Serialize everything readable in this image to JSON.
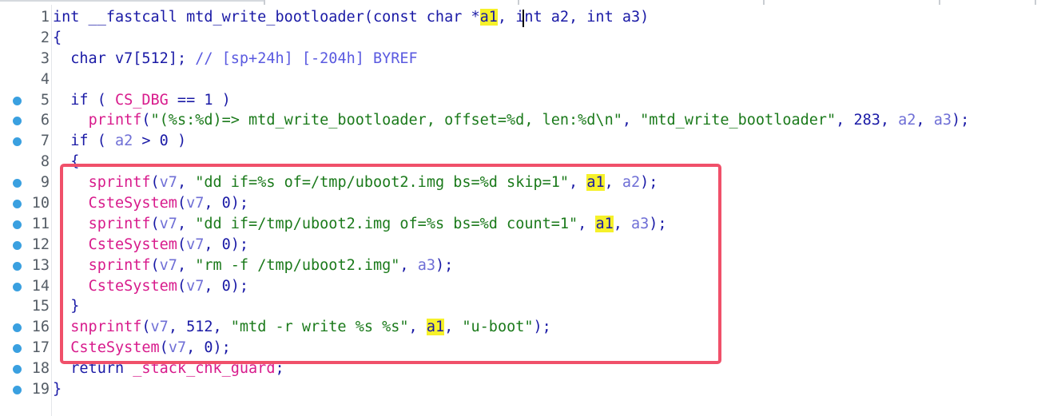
{
  "editor": {
    "lines": [
      {
        "num": "1",
        "bp": false,
        "tokens": [
          [
            "kt",
            "int __fastcall mtd_write_bootloader"
          ],
          [
            "p",
            "("
          ],
          [
            "kt",
            "const char *"
          ],
          [
            "hl",
            "a1"
          ],
          [
            "p",
            ", "
          ],
          [
            "kt",
            "int a2, int a3"
          ],
          [
            "p",
            ")"
          ]
        ]
      },
      {
        "num": "2",
        "bp": false,
        "tokens": [
          [
            "p",
            "{"
          ]
        ]
      },
      {
        "num": "3",
        "bp": false,
        "tokens": [
          [
            "kt",
            "  char v7"
          ],
          [
            "p",
            "["
          ],
          [
            "n",
            "512"
          ],
          [
            "p",
            "]; "
          ],
          [
            "c",
            "// [sp+24h] [-204h] BYREF"
          ]
        ]
      },
      {
        "num": "4",
        "bp": false,
        "tokens": []
      },
      {
        "num": "5",
        "bp": true,
        "tokens": [
          [
            "k",
            "  if ( "
          ],
          [
            "f",
            "CS_DBG"
          ],
          [
            "k",
            " == 1 )"
          ]
        ]
      },
      {
        "num": "6",
        "bp": true,
        "tokens": [
          [
            "p",
            "    "
          ],
          [
            "f",
            "printf"
          ],
          [
            "p",
            "("
          ],
          [
            "s",
            "\"(%s:%d)=> mtd_write_bootloader, offset=%d, len:%d\\n\""
          ],
          [
            "p",
            ", "
          ],
          [
            "s",
            "\"mtd_write_bootloader\""
          ],
          [
            "p",
            ", 283, "
          ],
          [
            "v",
            "a2"
          ],
          [
            "p",
            ", "
          ],
          [
            "v",
            "a3"
          ],
          [
            "p",
            ");"
          ]
        ]
      },
      {
        "num": "7",
        "bp": true,
        "tokens": [
          [
            "k",
            "  if ( "
          ],
          [
            "v",
            "a2"
          ],
          [
            "k",
            " > 0 )"
          ]
        ]
      },
      {
        "num": "8",
        "bp": false,
        "tokens": [
          [
            "p",
            "  {"
          ]
        ]
      },
      {
        "num": "9",
        "bp": true,
        "tokens": [
          [
            "p",
            "    "
          ],
          [
            "f",
            "sprintf"
          ],
          [
            "p",
            "("
          ],
          [
            "v",
            "v7"
          ],
          [
            "p",
            ", "
          ],
          [
            "s",
            "\"dd if=%s of=/tmp/uboot2.img bs=%d skip=1\""
          ],
          [
            "p",
            ", "
          ],
          [
            "hl",
            "a1"
          ],
          [
            "p",
            ", "
          ],
          [
            "v",
            "a2"
          ],
          [
            "p",
            ");"
          ]
        ]
      },
      {
        "num": "10",
        "bp": true,
        "tokens": [
          [
            "p",
            "    "
          ],
          [
            "f",
            "CsteSystem"
          ],
          [
            "p",
            "("
          ],
          [
            "v",
            "v7"
          ],
          [
            "p",
            ", 0);"
          ]
        ]
      },
      {
        "num": "11",
        "bp": true,
        "tokens": [
          [
            "p",
            "    "
          ],
          [
            "f",
            "sprintf"
          ],
          [
            "p",
            "("
          ],
          [
            "v",
            "v7"
          ],
          [
            "p",
            ", "
          ],
          [
            "s",
            "\"dd if=/tmp/uboot2.img of=%s bs=%d count=1\""
          ],
          [
            "p",
            ", "
          ],
          [
            "hl",
            "a1"
          ],
          [
            "p",
            ", "
          ],
          [
            "v",
            "a3"
          ],
          [
            "p",
            ");"
          ]
        ]
      },
      {
        "num": "12",
        "bp": true,
        "tokens": [
          [
            "p",
            "    "
          ],
          [
            "f",
            "CsteSystem"
          ],
          [
            "p",
            "("
          ],
          [
            "v",
            "v7"
          ],
          [
            "p",
            ", 0);"
          ]
        ]
      },
      {
        "num": "13",
        "bp": true,
        "tokens": [
          [
            "p",
            "    "
          ],
          [
            "f",
            "sprintf"
          ],
          [
            "p",
            "("
          ],
          [
            "v",
            "v7"
          ],
          [
            "p",
            ", "
          ],
          [
            "s",
            "\"rm -f /tmp/uboot2.img\""
          ],
          [
            "p",
            ", "
          ],
          [
            "v",
            "a3"
          ],
          [
            "p",
            ");"
          ]
        ]
      },
      {
        "num": "14",
        "bp": true,
        "tokens": [
          [
            "p",
            "    "
          ],
          [
            "f",
            "CsteSystem"
          ],
          [
            "p",
            "("
          ],
          [
            "v",
            "v7"
          ],
          [
            "p",
            ", 0);"
          ]
        ]
      },
      {
        "num": "15",
        "bp": false,
        "tokens": [
          [
            "p",
            "  }"
          ]
        ]
      },
      {
        "num": "16",
        "bp": true,
        "tokens": [
          [
            "p",
            "  "
          ],
          [
            "f",
            "snprintf"
          ],
          [
            "p",
            "("
          ],
          [
            "v",
            "v7"
          ],
          [
            "p",
            ", 512, "
          ],
          [
            "s",
            "\"mtd -r write %s %s\""
          ],
          [
            "p",
            ", "
          ],
          [
            "hl",
            "a1"
          ],
          [
            "p",
            ", "
          ],
          [
            "s",
            "\"u-boot\""
          ],
          [
            "p",
            ");"
          ]
        ]
      },
      {
        "num": "17",
        "bp": true,
        "tokens": [
          [
            "p",
            "  "
          ],
          [
            "f",
            "CsteSystem"
          ],
          [
            "p",
            "("
          ],
          [
            "v",
            "v7"
          ],
          [
            "p",
            ", 0);"
          ]
        ]
      },
      {
        "num": "18",
        "bp": true,
        "tokens": [
          [
            "k",
            "  return "
          ],
          [
            "f",
            "_stack_chk_guard"
          ],
          [
            "p",
            ";"
          ]
        ]
      },
      {
        "num": "19",
        "bp": true,
        "tokens": [
          [
            "p",
            "}"
          ]
        ]
      }
    ],
    "highlight_box_color": "#f0506a",
    "breakpoint_color": "#3aa0e0",
    "highlight_color": "#f6f12a"
  }
}
